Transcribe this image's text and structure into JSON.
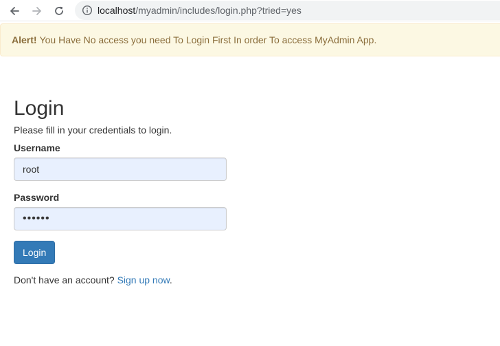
{
  "browser": {
    "url_host": "localhost",
    "url_path": "/myadmin/includes/login.php?tried=yes"
  },
  "alert": {
    "strong": "Alert!",
    "message": "You Have No access you need To Login First In order To access MyAdmin App."
  },
  "login": {
    "title": "Login",
    "subtitle": "Please fill in your credentials to login.",
    "username_label": "Username",
    "username_value": "root",
    "password_label": "Password",
    "password_value": "••••••",
    "submit_label": "Login",
    "signup_prompt": "Don't have an account?",
    "signup_link": "Sign up now",
    "signup_suffix": "."
  },
  "colors": {
    "primary": "#337ab7",
    "alert_bg": "#fcf8e3",
    "alert_text": "#8a6d3b",
    "autofill_bg": "#e8f0fe"
  },
  "icons": [
    "back-arrow-icon",
    "forward-arrow-icon",
    "reload-icon",
    "info-icon"
  ]
}
